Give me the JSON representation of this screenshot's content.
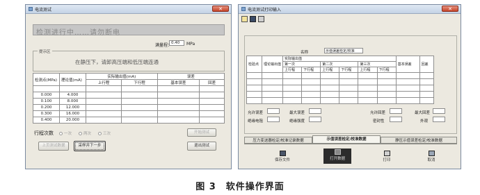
{
  "left_window": {
    "title": "电流测试",
    "close_label": "✕",
    "status": "检测进行中……请勿断电",
    "range_label": "满量程：",
    "range_value": "0.40",
    "range_unit": "MPa",
    "hint_group_title": "提示区",
    "hint_text": "在静压下，请卸高压端和低压端连通",
    "table": {
      "col_headers": [
        "检测点(MPa)",
        "理论值(mA)",
        "实际输出值(mA)",
        "误差"
      ],
      "sub_headers": [
        "上行程",
        "下行程",
        "基本误差",
        "回差"
      ],
      "rows": [
        [
          "0.000",
          "4.000"
        ],
        [
          "0.100",
          "8.000"
        ],
        [
          "0.200",
          "12.000"
        ],
        [
          "0.300",
          "16.000"
        ],
        [
          "0.400",
          "20.000"
        ]
      ]
    },
    "trip_label": "行程次数",
    "trip_options": [
      "一次",
      "两次",
      "三次"
    ],
    "buttons": {
      "start": "开始测试",
      "prev": "上页测试数据",
      "next": "采样并下一步",
      "exit": "退出测试"
    }
  },
  "right_window": {
    "title": "电流测试打印输入",
    "close_label": "✕",
    "name_label": "名称",
    "name_value": "示值误差检定/校准",
    "table_headers": {
      "col1": "检验点",
      "col2": "理论输出值",
      "group": "实际输出值",
      "first": "第一次",
      "second": "第二次",
      "third": "第三次",
      "up": "上行程",
      "down": "下行程",
      "basic_err": "基本误差",
      "hysteresis": "回差"
    },
    "fields": {
      "allow_err": "允许误差",
      "max_err": "最大误差",
      "allow_hys": "允许回差",
      "max_hys": "最大回差",
      "insulation": "绝缘电阻",
      "insulation_strength": "绝缘强度",
      "sealing": "密封性",
      "appearance": "外观"
    },
    "tabs": [
      "压力变送器检定/校准记录数据",
      "示值误差检定/校准数据",
      "静压示值误差检定/校准数据"
    ],
    "bottom_buttons": [
      "保存文件",
      "打开数据",
      "打印",
      "取消"
    ]
  },
  "caption": "图 3　软件操作界面"
}
